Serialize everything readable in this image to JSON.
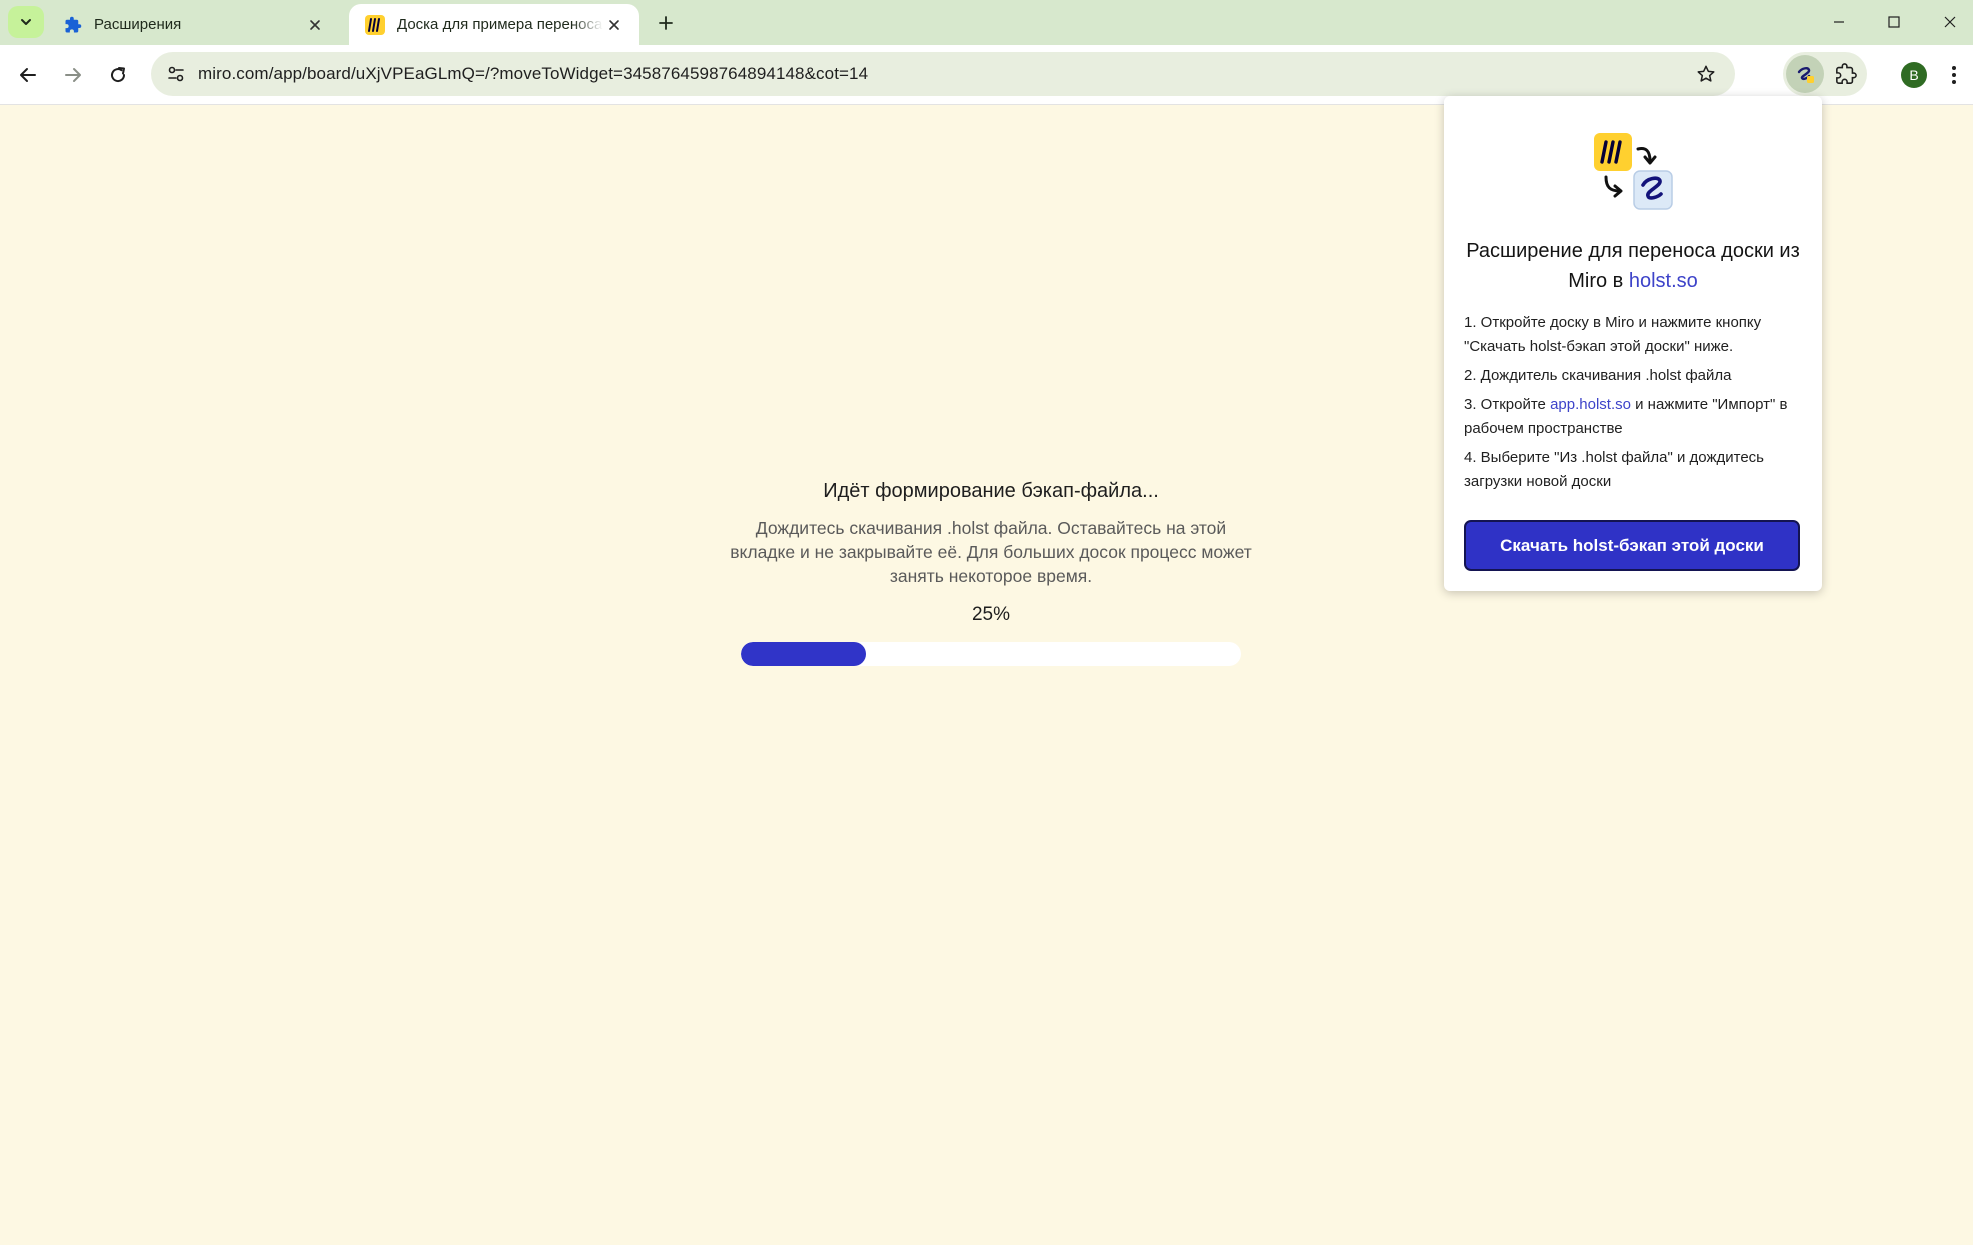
{
  "browser": {
    "tabs": [
      {
        "title": "Расширения",
        "active": false
      },
      {
        "title": "Доска для примера переноса",
        "active": true
      }
    ],
    "url": "miro.com/app/board/uXjVPEaGLmQ=/?moveToWidget=3458764598764894148&cot=14",
    "profile_initial": "B"
  },
  "page": {
    "title": "Идёт формирование бэкап-файла...",
    "description": "Дождитесь скачивания .holst файла. Оставайтесь на этой вкладке и не закрывайте её. Для больших досок процесс может занять некоторое время.",
    "progress_label": "25%",
    "progress_value": 25
  },
  "popup": {
    "title_prefix": "Расширение для переноса доски из Miro в ",
    "title_link": "holst.so",
    "step1": "1. Откройте доску в Miro и нажмите кнопку \"Скачать holst-бэкап этой доски\" ниже.",
    "step2": "2. Дождитель скачивания .holst файла",
    "step3_before": "3. Откройте ",
    "step3_link": "app.holst.so",
    "step3_after": " и нажмите \"Импорт\" в рабочем пространстве",
    "step4": "4. Выберите \"Из .holst файла\" и дождитесь загрузки новой доски",
    "button_label": "Скачать holst-бэкап этой доски"
  },
  "colors": {
    "page_bg": "#fdf8e3",
    "accent": "#3034c8",
    "miro_yellow": "#ffd02f"
  }
}
